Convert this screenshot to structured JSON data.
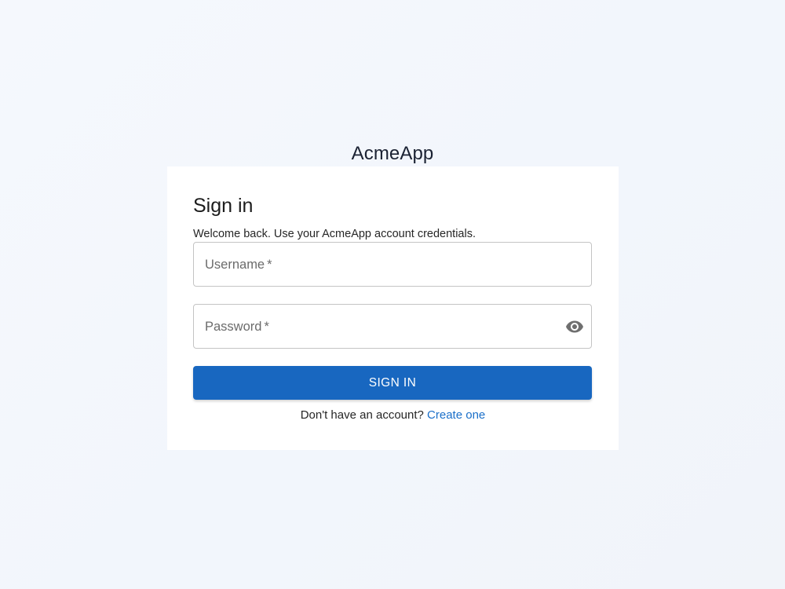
{
  "app": {
    "brand_name": "AcmeApp"
  },
  "signin_card": {
    "title": "Sign in",
    "subtitle": "Welcome back. Use your AcmeApp account credentials.",
    "username": {
      "label": "Username",
      "required_marker": "*",
      "value": ""
    },
    "password": {
      "label": "Password",
      "required_marker": "*",
      "value": "",
      "toggle_icon": "eye-icon"
    },
    "submit_label": "SIGN IN",
    "footer_prompt": "Don't have an account?",
    "footer_link": "Create one"
  },
  "colors": {
    "primary": "#1867c0",
    "link": "#1a6fc9",
    "background": "#f3f7fc",
    "card": "#ffffff"
  }
}
